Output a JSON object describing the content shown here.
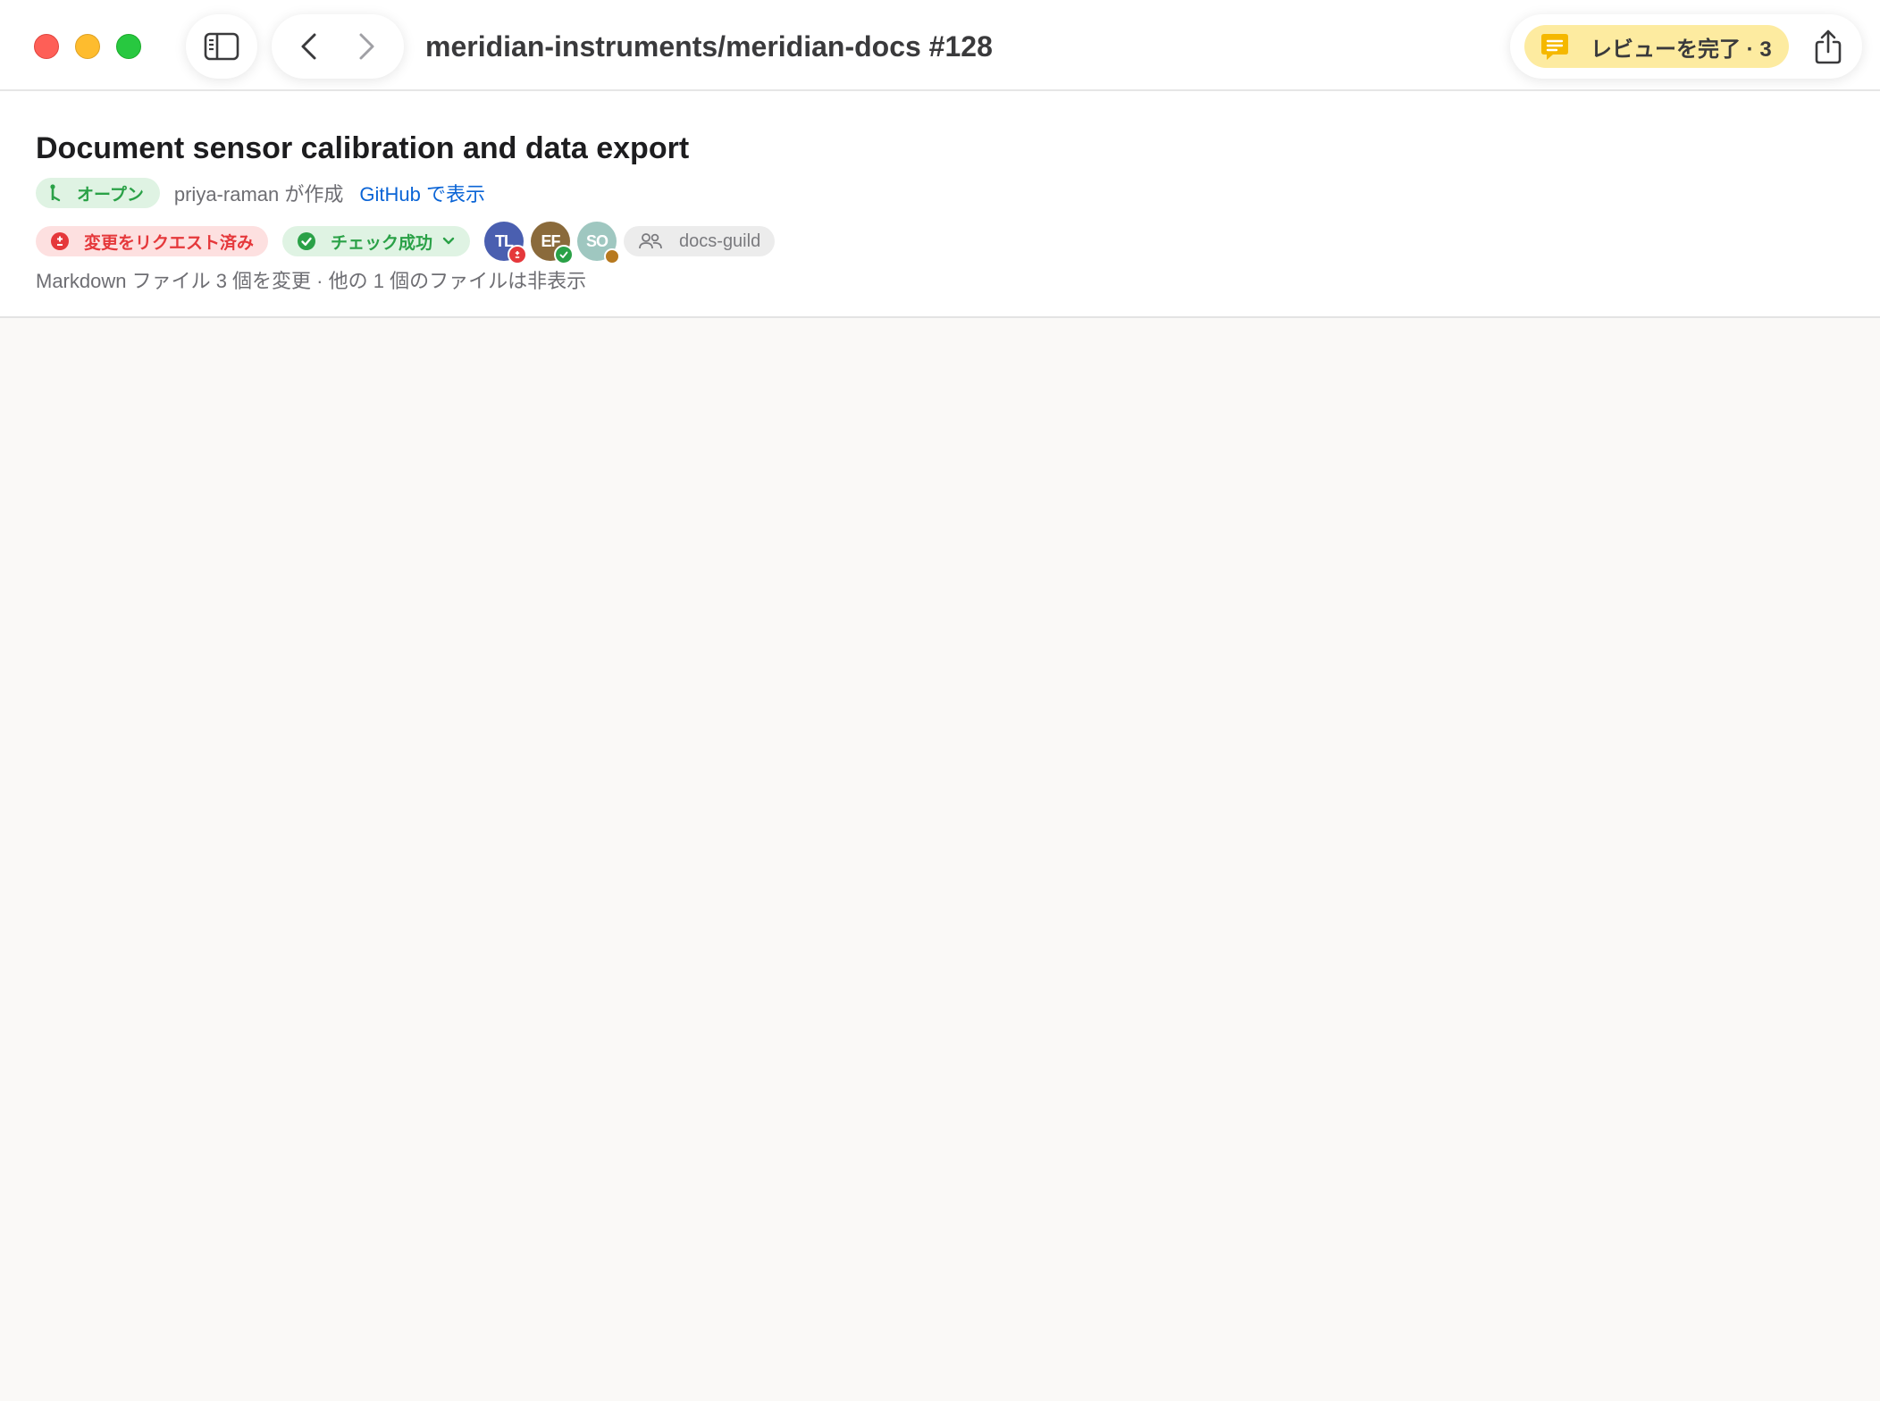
{
  "window": {
    "title": "meridian-instruments/meridian-docs #128",
    "traffic_lights": [
      "close",
      "minimize",
      "zoom"
    ]
  },
  "toolbar": {
    "sidebar_icon": "sidebar-toggle-icon",
    "back_icon": "chevron-left-icon",
    "forward_icon": "chevron-right-icon",
    "review_button_label": "レビューを完了 · 3",
    "review_icon": "comment-icon",
    "share_icon": "share-icon"
  },
  "pr": {
    "title": "Document sensor calibration and data export",
    "state_label": "オープン",
    "author_text": "priya-raman が作成",
    "github_link_label": "GitHub で表示",
    "review_status_label": "変更をリクエスト済み",
    "checks_label": "チェック成功",
    "reviewers": [
      {
        "initials": "TL",
        "color": "#4a5fb0",
        "status": "changes-requested",
        "status_color": "#e5383b"
      },
      {
        "initials": "EF",
        "color": "#8a6a3b",
        "status": "approved",
        "status_color": "#2aa147"
      },
      {
        "initials": "SO",
        "color": "#9fc7c0",
        "status": "pending",
        "status_color": "#b7791f"
      }
    ],
    "team_label": "docs-guild",
    "files_summary": "Markdown ファイル 3 個を変更 · 他の 1 個のファイルは非表示"
  },
  "colors": {
    "accent_link": "#0a64d6",
    "open_green": "#2aa147",
    "changes_red": "#e5383b",
    "review_yellow": "#fdeba0",
    "background": "#faf9f7"
  }
}
